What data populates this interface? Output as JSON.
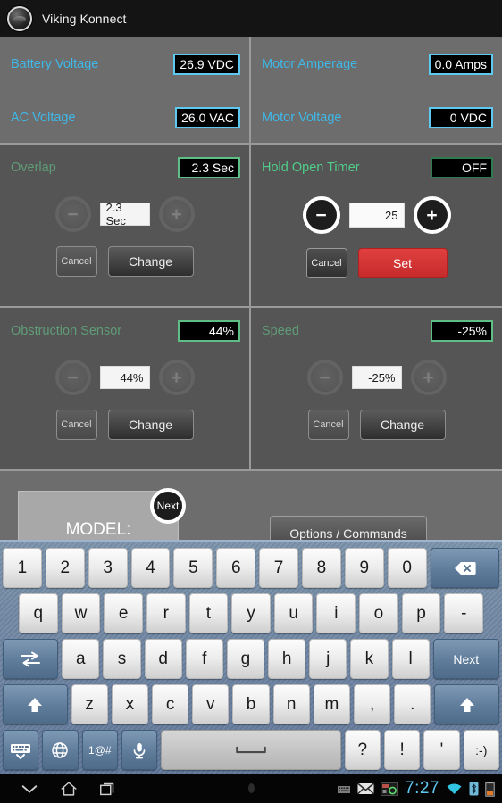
{
  "titlebar": {
    "app_name": "Viking Konnect",
    "logo_icon": "viking-logo-icon"
  },
  "readouts": {
    "left": [
      {
        "label": "Battery Voltage",
        "value": "26.9 VDC"
      },
      {
        "label": "AC Voltage",
        "value": "26.0 VAC"
      }
    ],
    "right": [
      {
        "label": "Motor Amperage",
        "value": "0.0 Amps"
      },
      {
        "label": "Motor Voltage",
        "value": "0 VDC"
      }
    ]
  },
  "controls": {
    "overlap": {
      "title": "Overlap",
      "badge": "2.3 Sec",
      "field_value": "2.3 Sec",
      "minus": "−",
      "plus": "+",
      "cancel": "Cancel",
      "confirm": "Change",
      "enabled": false
    },
    "hold_open_timer": {
      "title": "Hold Open Timer",
      "badge": "OFF",
      "field_value": "25",
      "minus": "−",
      "plus": "+",
      "cancel": "Cancel",
      "confirm": "Set",
      "enabled": true
    },
    "obstruction_sensor": {
      "title": "Obstruction Sensor",
      "badge": "44%",
      "field_value": "44%",
      "minus": "−",
      "plus": "+",
      "cancel": "Cancel",
      "confirm": "Change",
      "enabled": false
    },
    "speed": {
      "title": "Speed",
      "badge": "-25%",
      "field_value": "-25%",
      "minus": "−",
      "plus": "+",
      "cancel": "Cancel",
      "confirm": "Change",
      "enabled": false
    }
  },
  "bottom": {
    "model_label": "MODEL:",
    "next_badge": "Next",
    "options_button": "Options / Commands"
  },
  "keyboard": {
    "row_numbers": [
      "1",
      "2",
      "3",
      "4",
      "5",
      "6",
      "7",
      "8",
      "9",
      "0"
    ],
    "backspace_icon": "backspace-icon",
    "row_q": [
      "q",
      "w",
      "e",
      "r",
      "t",
      "y",
      "u",
      "i",
      "o",
      "p",
      "-"
    ],
    "tab_icon": "tab-icon",
    "row_a": [
      "a",
      "s",
      "d",
      "f",
      "g",
      "h",
      "j",
      "k",
      "l"
    ],
    "next_key": "Next",
    "shift_icon": "shift-icon",
    "row_z": [
      "z",
      "x",
      "c",
      "v",
      "b",
      "n",
      "m",
      ",",
      "."
    ],
    "hide_keyboard_icon": "hide-keyboard-icon",
    "globe_icon": "globe-icon",
    "symbols_key": "1@#",
    "mic_icon": "microphone-icon",
    "space_icon": "space-icon",
    "row_punct": [
      "?",
      "!",
      "'",
      ":-)"
    ]
  },
  "navbar": {
    "back_icon": "back-icon",
    "home_icon": "home-icon",
    "recents_icon": "recent-apps-icon",
    "keyboard_status_icon": "keyboard-status-icon",
    "mail_icon": "gmail-icon",
    "app_status_icon": "app-status-icon",
    "time": "7:27",
    "wifi_icon": "wifi-icon",
    "bluetooth_icon": "bluetooth-icon",
    "battery_icon": "battery-icon"
  },
  "colors": {
    "accent_cyan": "#5ec8f0",
    "accent_green": "#4fcf8a",
    "danger_red": "#c62a2b",
    "panel_bg": "#555555",
    "top_panel_bg": "#6d6d6d"
  }
}
